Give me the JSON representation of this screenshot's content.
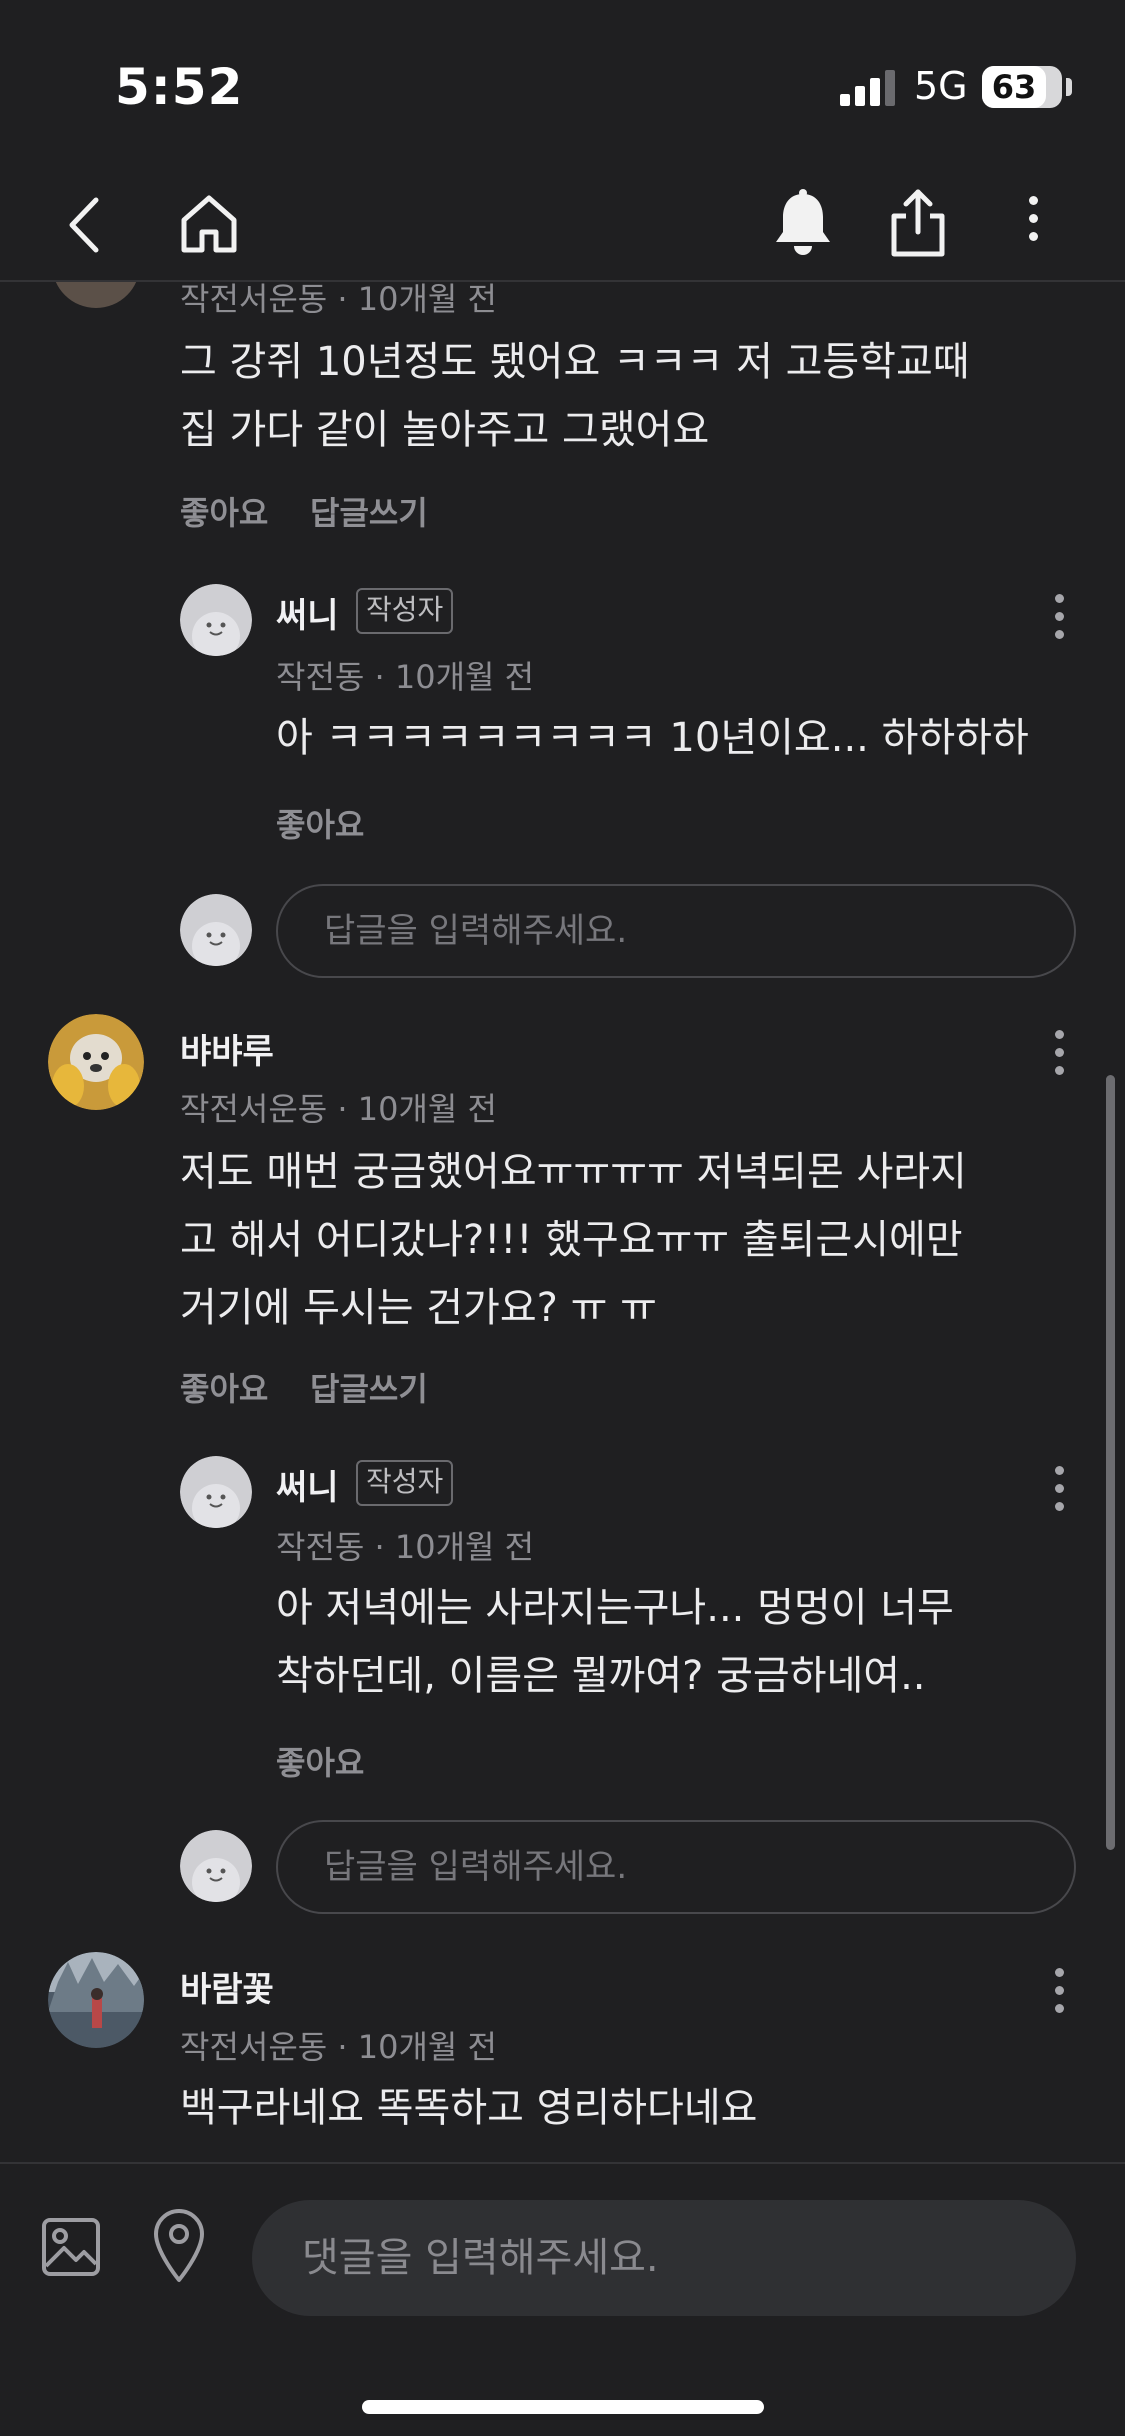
{
  "status_bar": {
    "time": "5:52",
    "network": "5G",
    "battery": "63"
  },
  "comments": [
    {
      "region": "작전서운동",
      "time": "10개월 전",
      "text": "그 강쥐 10년정도 됐어요 ㅋㅋㅋ 저 고등학교때\n집 가다 같이 놀아주고 그랬어요",
      "like": "좋아요",
      "reply": "답글쓰기",
      "replies": [
        {
          "name": "써니",
          "tag": "작성자",
          "region": "작전동",
          "time": "10개월 전",
          "text": "아 ㅋㅋㅋㅋㅋㅋㅋㅋㅋ 10년이요... 하하하하",
          "like": "좋아요"
        }
      ],
      "reply_placeholder": "답글을 입력해주세요."
    },
    {
      "name": "뱌뱌루",
      "region": "작전서운동",
      "time": "10개월 전",
      "text": "저도 매번 궁금했어요ㅠㅠㅠㅠ 저녁되몬 사라지\n고 해서 어디갔나?!!! 했구요ㅠㅠ 출퇴근시에만\n거기에 두시는 건가요? ㅠ ㅠ",
      "like": "좋아요",
      "reply": "답글쓰기",
      "replies": [
        {
          "name": "써니",
          "tag": "작성자",
          "region": "작전동",
          "time": "10개월 전",
          "text": "아 저녁에는 사라지는구나... 멍멍이 너무\n착하던데, 이름은 뭘까여? 궁금하네여..",
          "like": "좋아요"
        }
      ],
      "reply_placeholder": "답글을 입력해주세요."
    },
    {
      "name": "바람꽃",
      "region": "작전서운동",
      "time": "10개월 전",
      "text": "백구라네요 똑똑하고 영리하다네요"
    }
  ],
  "meta_separator": "·",
  "comment_input": {
    "placeholder": "댓글을 입력해주세요."
  },
  "colors": {
    "background": "#1f1f21",
    "text": "#ececee",
    "muted": "#8d8d92"
  },
  "icons": [
    "back-icon",
    "home-icon",
    "bell-icon",
    "share-icon",
    "more-icon",
    "image-icon",
    "location-icon"
  ]
}
